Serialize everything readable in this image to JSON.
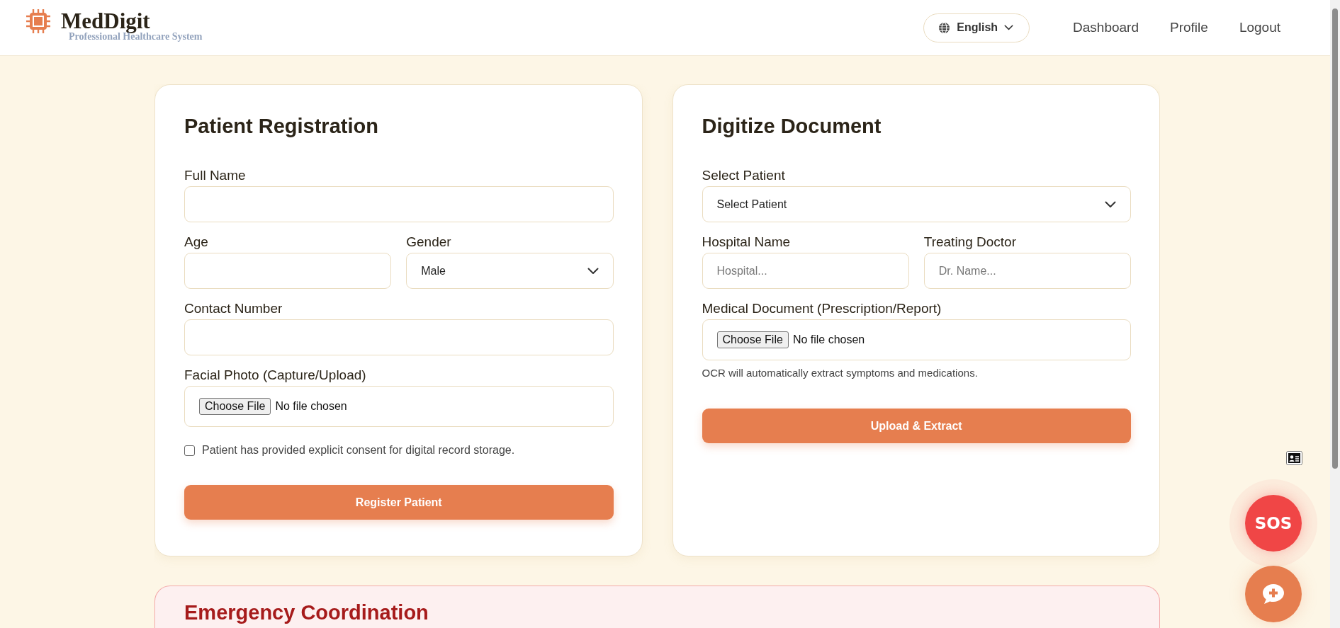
{
  "header": {
    "brand": "MedDigit",
    "tagline": "Professional Healthcare System",
    "language": "English",
    "nav": [
      {
        "label": "Dashboard"
      },
      {
        "label": "Profile"
      },
      {
        "label": "Logout"
      }
    ]
  },
  "registration": {
    "title": "Patient Registration",
    "rows": [
      [
        {
          "kind": "text",
          "label": "Full Name"
        }
      ],
      [
        {
          "kind": "text",
          "label": "Age"
        },
        {
          "kind": "select",
          "label": "Gender",
          "value": "Male"
        }
      ],
      [
        {
          "kind": "text",
          "label": "Contact Number"
        }
      ],
      [
        {
          "kind": "file",
          "label": "Facial Photo (Capture/Upload)",
          "button": "Choose File",
          "status": "No file chosen"
        }
      ]
    ],
    "consent": {
      "label": "Patient has provided explicit consent for digital record storage.",
      "checked": false
    },
    "submit": "Register Patient"
  },
  "digitize": {
    "title": "Digitize Document",
    "rows": [
      [
        {
          "kind": "select",
          "label": "Select Patient",
          "value": "Select Patient"
        }
      ],
      [
        {
          "kind": "text",
          "label": "Hospital Name",
          "placeholder": "Hospital..."
        },
        {
          "kind": "text",
          "label": "Treating Doctor",
          "placeholder": "Dr. Name..."
        }
      ],
      [
        {
          "kind": "file",
          "label": "Medical Document (Prescription/Report)",
          "button": "Choose File",
          "status": "No file chosen"
        }
      ]
    ],
    "hint": "OCR will automatically extract symptoms and medications.",
    "submit": "Upload & Extract"
  },
  "emergency": {
    "title": "Emergency Coordination"
  },
  "floating": {
    "sos": "SOS"
  }
}
